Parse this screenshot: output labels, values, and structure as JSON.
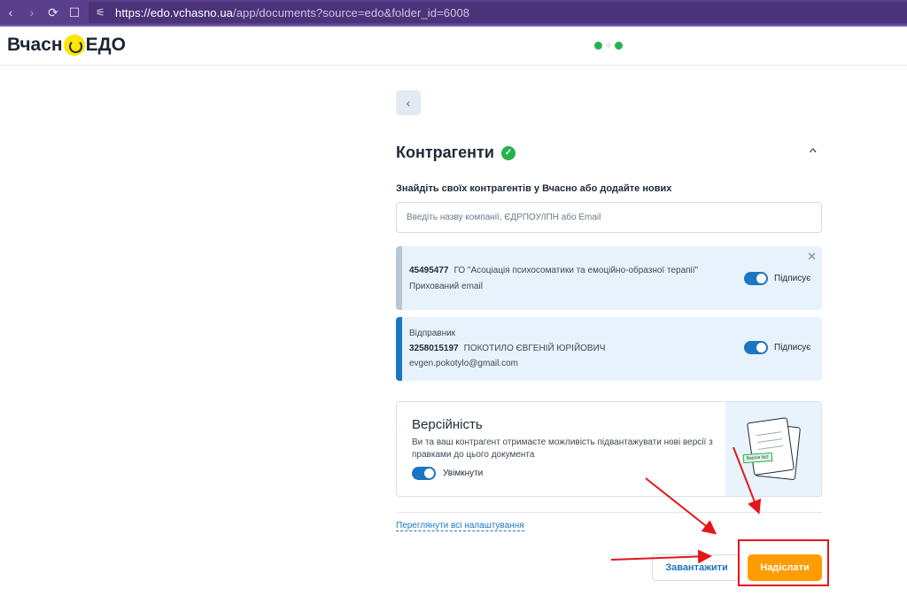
{
  "browser": {
    "back": "‹",
    "forward": "›",
    "reload": "⟳",
    "bookmark": "☐",
    "tune": "⚟",
    "url_host": "https://edo.vchasno.ua",
    "url_path": "/app/documents?source=edo&folder_id=6008"
  },
  "header": {
    "logo_left": "Вчасн",
    "logo_right": "ЕДО"
  },
  "panel": {
    "back_icon": "‹",
    "title": "Контрагенти",
    "title_check": "✓",
    "collapse_icon": "^",
    "find_label": "Знайдіть своїх контрагентів у Вчасно або додайте нових",
    "search_placeholder": "Введіть назву компанії, ЄДРПОУ/ІПН або Email"
  },
  "parties": [
    {
      "role": "",
      "code": "45495477",
      "name": "ГО \"Асоціація психосоматики та емоційно-образної терапії\"",
      "email": "Прихований email",
      "sign_label": "Підписує",
      "close": "✕"
    },
    {
      "role": "Відправник",
      "code": "3258015197",
      "name": "ПОКОТИЛО ЄВГЕНІЙ ЮРІЙОВИЧ",
      "email": "evgen.pokotylo@gmail.com",
      "sign_label": "Підписує"
    }
  ],
  "versions": {
    "title": "Версійність",
    "description": "Ви та ваш контрагент отримаєте можливість підвантажувати нові версії з правками до цього документа",
    "toggle_label": "Увімкнути",
    "illustration_tag": "Версія №2"
  },
  "footer": {
    "settings_link": "Переглянути всі налаштування",
    "download_label": "Завантажити",
    "send_label": "Надіслати"
  },
  "colors": {
    "brand_purple": "#5a3f8c",
    "accent_blue": "#1a76c3",
    "send_orange": "#ff9d00",
    "success_green": "#26b34a",
    "annotation_red": "#e3161b"
  }
}
